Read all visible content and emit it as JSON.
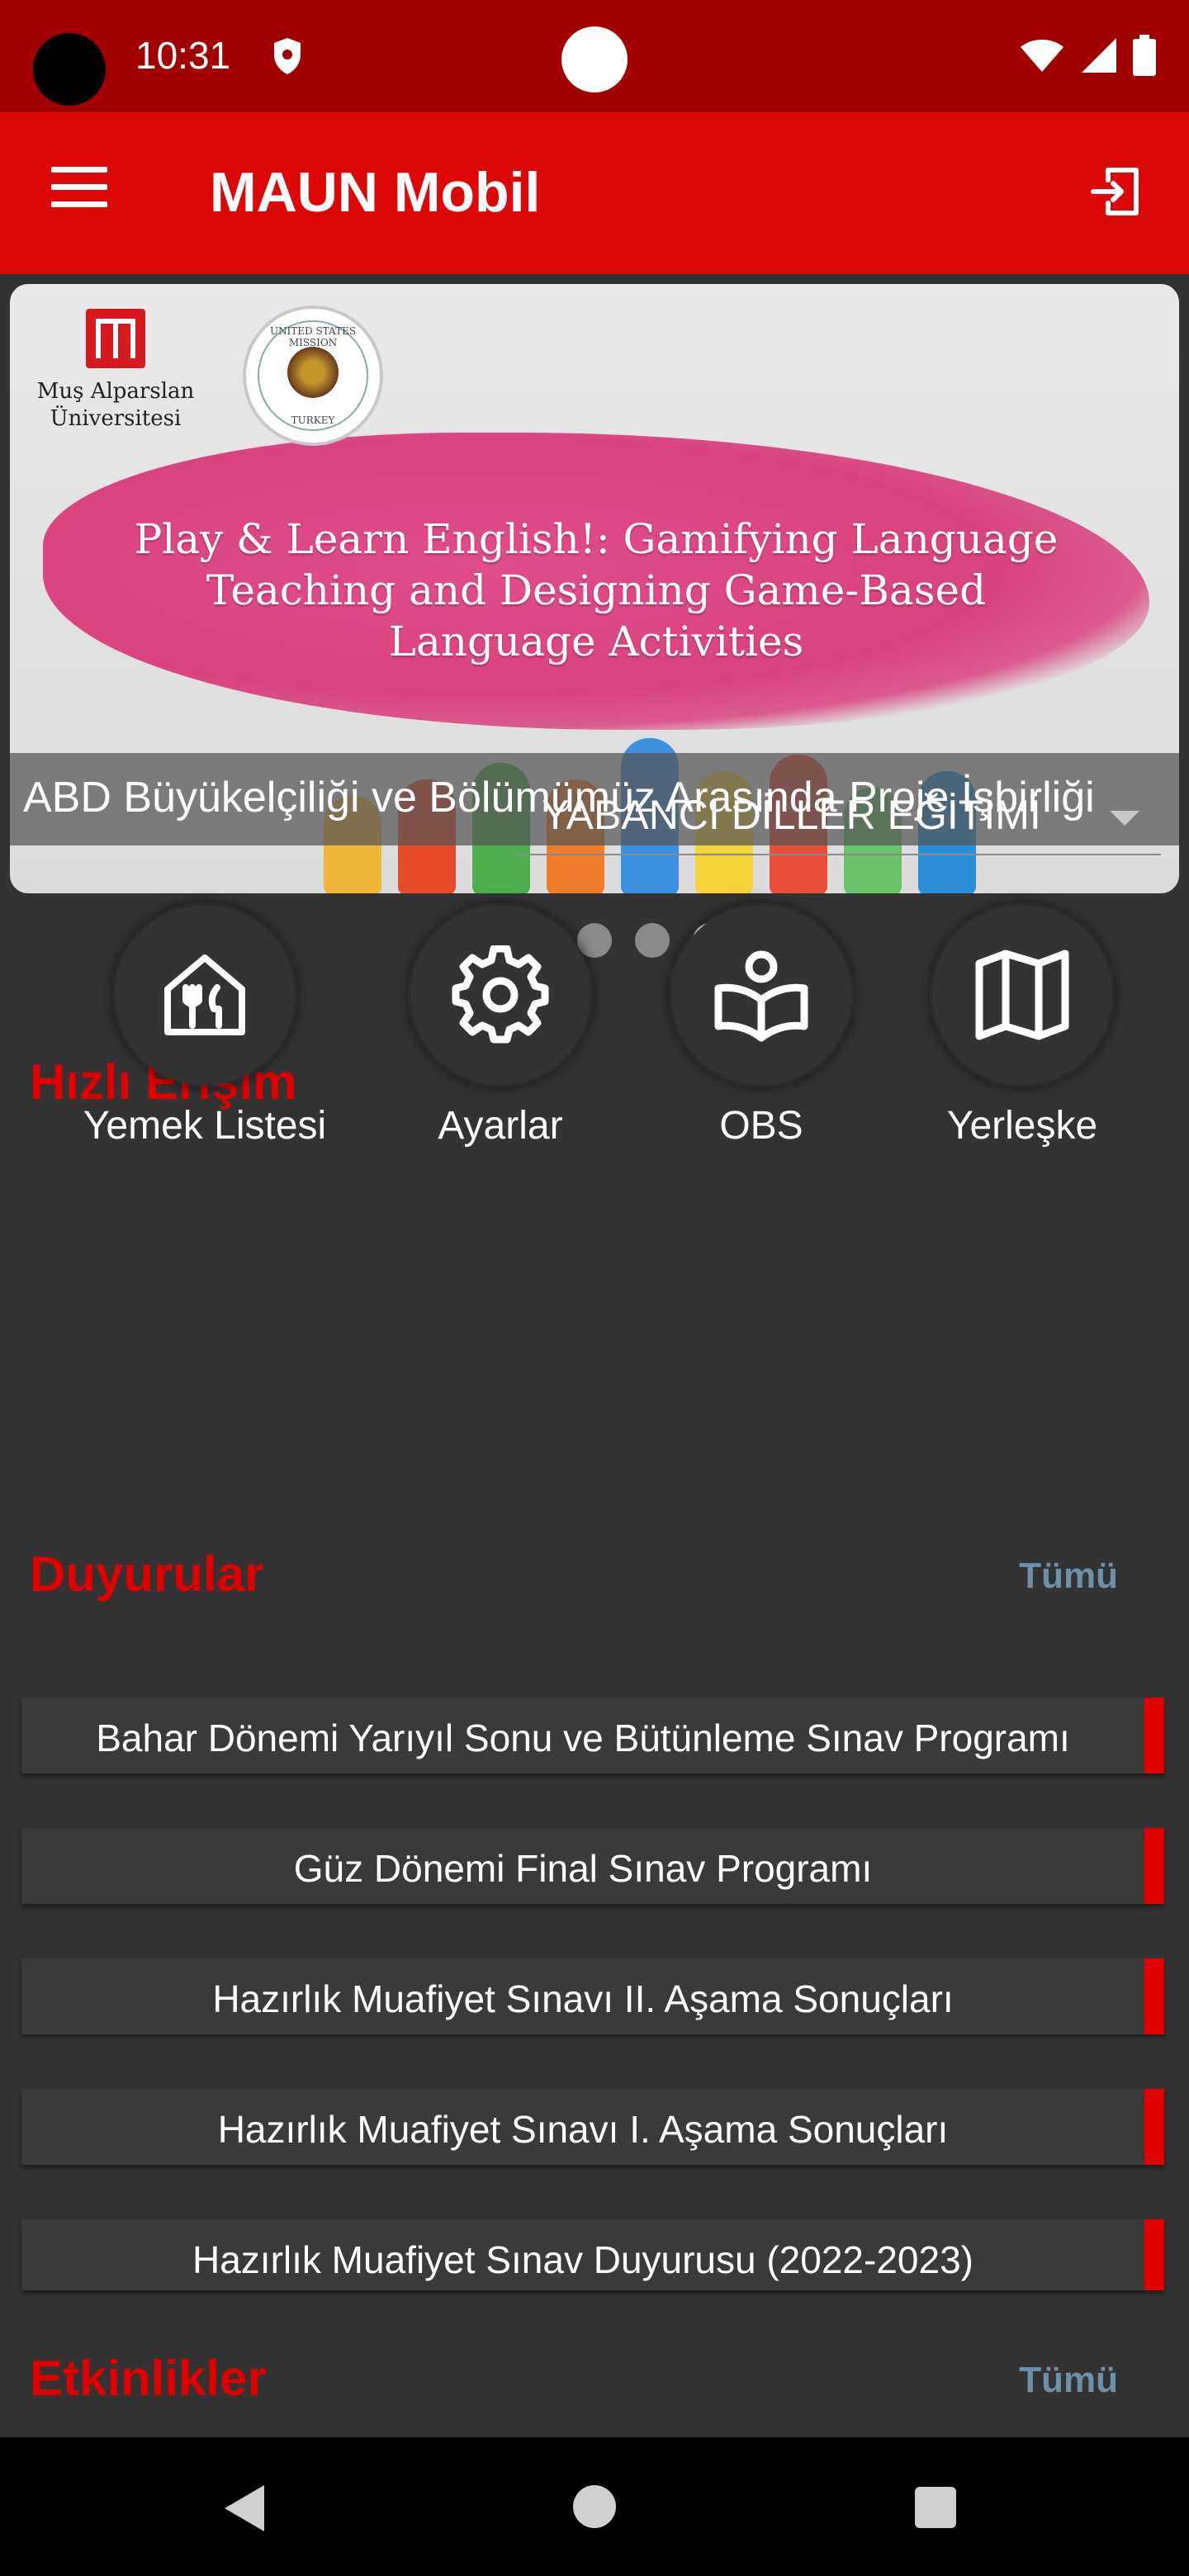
{
  "status_bar": {
    "time": "10:31"
  },
  "app_bar": {
    "title": "MAUN Mobil"
  },
  "banner": {
    "logo_text_line1": "Muş Alparslan",
    "logo_text_line2": "Üniversitesi",
    "seal_top": "UNITED STATES MISSION",
    "seal_bottom": "TURKEY",
    "heading": "Play & Learn English!: Gamifying Language Teaching and Designing Game-Based Language Activities",
    "caption": "ABD Büyükelçiliği ve Bölümümüz Arasında Proje İşbirliği",
    "page_count": 5,
    "active_page": 5
  },
  "quick_access": {
    "title": "Hızlı Erişim",
    "department": "YABANCI DİLLER EĞİTİMİ",
    "items": [
      {
        "label": "Yemek Listesi",
        "icon": "restaurant-icon"
      },
      {
        "label": "Ayarlar",
        "icon": "gear-icon"
      },
      {
        "label": "OBS",
        "icon": "reader-book-icon"
      },
      {
        "label": "Yerleşke",
        "icon": "map-icon"
      }
    ]
  },
  "announcements": {
    "title": "Duyurular",
    "see_all": "Tümü",
    "items": [
      "Bahar Dönemi Yarıyıl Sonu ve Bütünleme Sınav Programı",
      "Güz Dönemi Final Sınav Programı",
      "Hazırlık Muafiyet Sınavı II. Aşama Sonuçları",
      "Hazırlık Muafiyet Sınavı I. Aşama Sonuçları",
      "Hazırlık Muafiyet Sınav Duyurusu (2022-2023)"
    ]
  },
  "events": {
    "title": "Etkinlikler",
    "see_all": "Tümü"
  },
  "colors": {
    "primary": "#dc0707",
    "status_bar": "#a10000",
    "background": "#333333",
    "accent_link": "#6d8fa8"
  }
}
